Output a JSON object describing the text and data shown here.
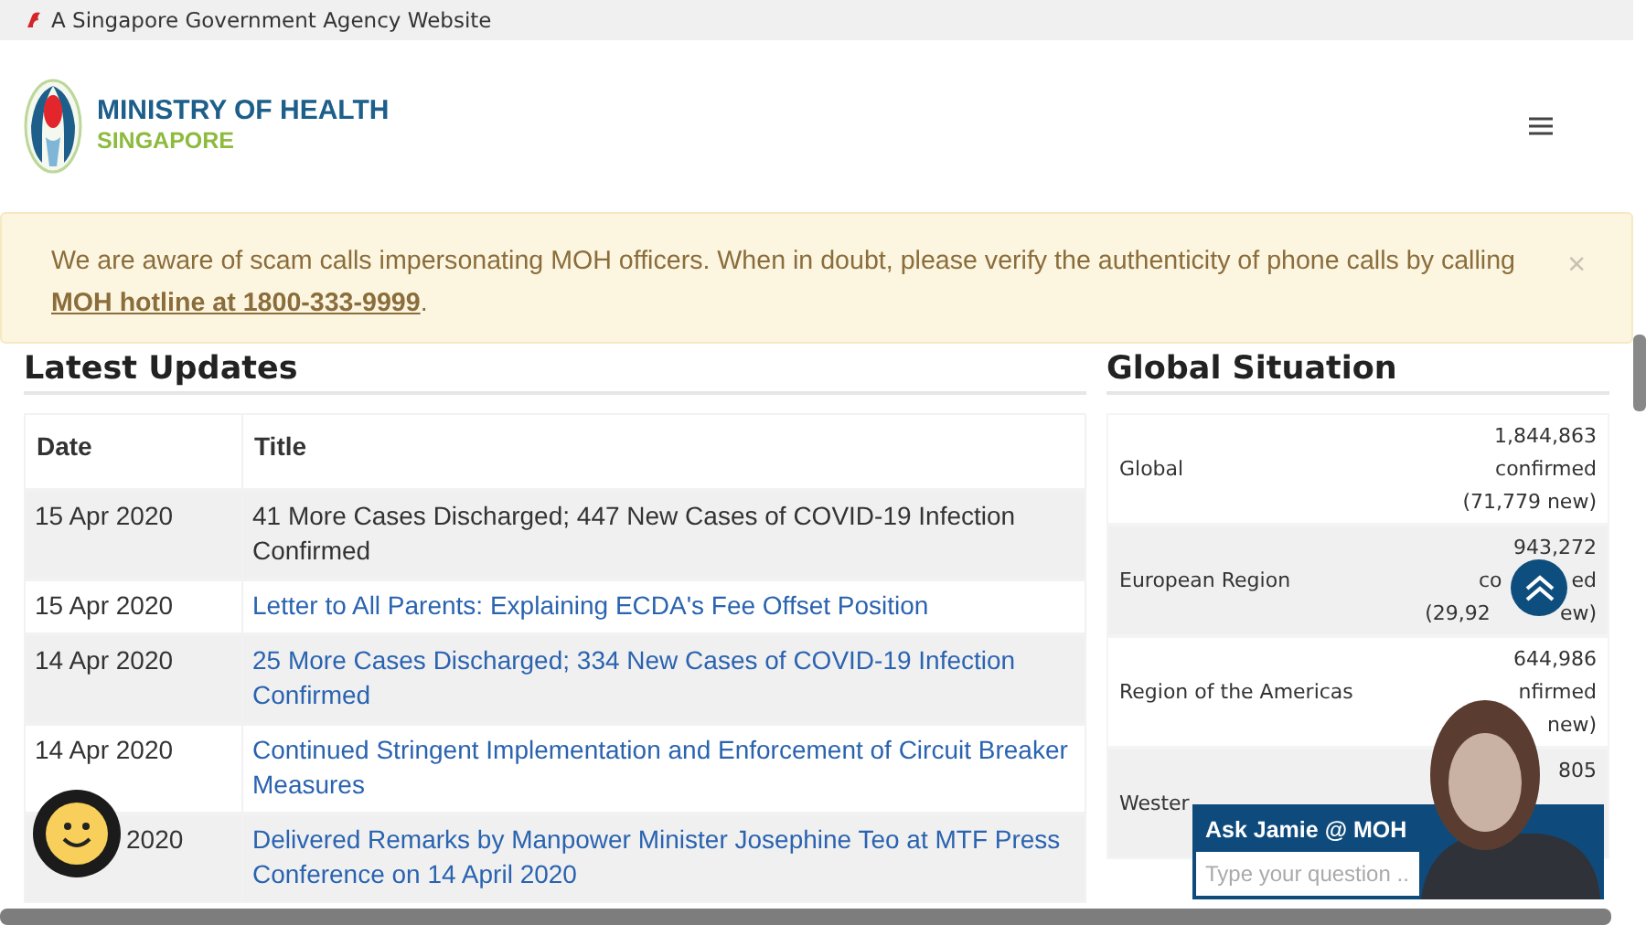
{
  "gov_banner": {
    "text": "A Singapore Government Agency Website"
  },
  "header": {
    "logo_title": "MINISTRY OF HEALTH",
    "logo_subtitle": "SINGAPORE"
  },
  "alert": {
    "text": "We are aware of scam calls impersonating MOH officers. When in doubt, please verify the authenticity of phone calls by calling",
    "link": "MOH hotline at 1800-333-9999",
    "after": ".",
    "close": "×"
  },
  "latest_updates": {
    "title": "Latest Updates",
    "columns": [
      "Date",
      "Title"
    ],
    "rows": [
      {
        "date": "15 Apr 2020",
        "title": "41 More Cases Discharged; 447 New Cases of COVID-19 Infection Confirmed",
        "kind": "text"
      },
      {
        "date": "15 Apr 2020",
        "title": "Letter to All Parents: Explaining ECDA's Fee Offset Position",
        "kind": "link"
      },
      {
        "date": "14 Apr 2020",
        "title": "25 More Cases Discharged; 334 New Cases of COVID-19 Infection Confirmed",
        "kind": "link"
      },
      {
        "date": "14 Apr 2020",
        "title": "Continued Stringent Implementation and Enforcement of Circuit Breaker Measures",
        "kind": "link"
      },
      {
        "date": "2020",
        "title": "Delivered Remarks by Manpower Minister Josephine Teo at MTF Press Conference on 14 April 2020",
        "kind": "link"
      }
    ]
  },
  "global_situation": {
    "title": "Global Situation",
    "rows": [
      {
        "region": "Global",
        "lines": [
          [
            "1,844,863"
          ],
          [
            "confirmed"
          ],
          [
            "(71,779 new)"
          ]
        ]
      },
      {
        "region": "European Region",
        "lines": [
          [
            "943,272"
          ],
          [
            "co",
            "ed"
          ],
          [
            "(29,92",
            "ew)"
          ]
        ]
      },
      {
        "region": "Region of the Americas",
        "lines": [
          [
            "644,986"
          ],
          [
            "nfirmed"
          ],
          [
            "new)"
          ]
        ]
      },
      {
        "region": "Wester",
        "lines": [
          [
            "805"
          ]
        ]
      }
    ]
  },
  "chat_widget": {
    "title": "Ask Jamie @ MOH",
    "placeholder": "Type your question ..."
  }
}
